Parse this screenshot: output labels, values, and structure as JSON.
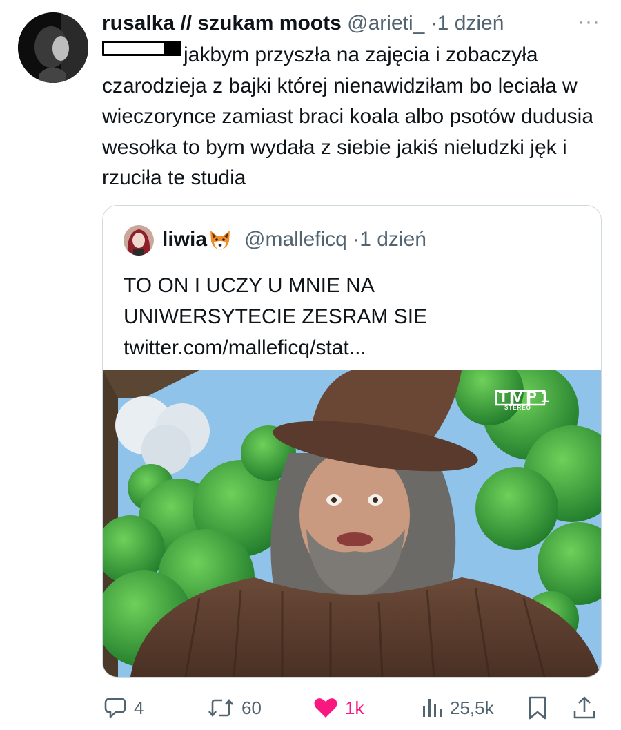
{
  "tweet": {
    "display_name": "rusalka // szukam moots",
    "handle": "@arieti_",
    "separator": "·",
    "time": "1 dzień",
    "more": "···",
    "text": "jakbym przyszła na zajęcia i zobaczyła czarodzieja z bajki której nienawidziłam bo leciała w wieczorynce zamiast braci koala albo psotów dudusia wesołka to bym wydała z siebie jakiś nieludzki jęk i rzuciła te studia"
  },
  "quote": {
    "display_name": "liwia",
    "emoji_icon": "fox-icon",
    "handle": "@malleficq",
    "separator": "·",
    "time": "1 dzień",
    "text_line1": "TO ON I UCZY U MNIE NA",
    "text_line2": "UNIWERSYTECIE ZESRAM SIE",
    "link": "twitter.com/malleficq/stat...",
    "media_watermark": "TVP1",
    "media_watermark_sub": "STEREO"
  },
  "actions": {
    "replies": "4",
    "retweets": "60",
    "likes": "1k",
    "views": "25,5k",
    "like_color": "#f91880",
    "muted_color": "#536471"
  }
}
